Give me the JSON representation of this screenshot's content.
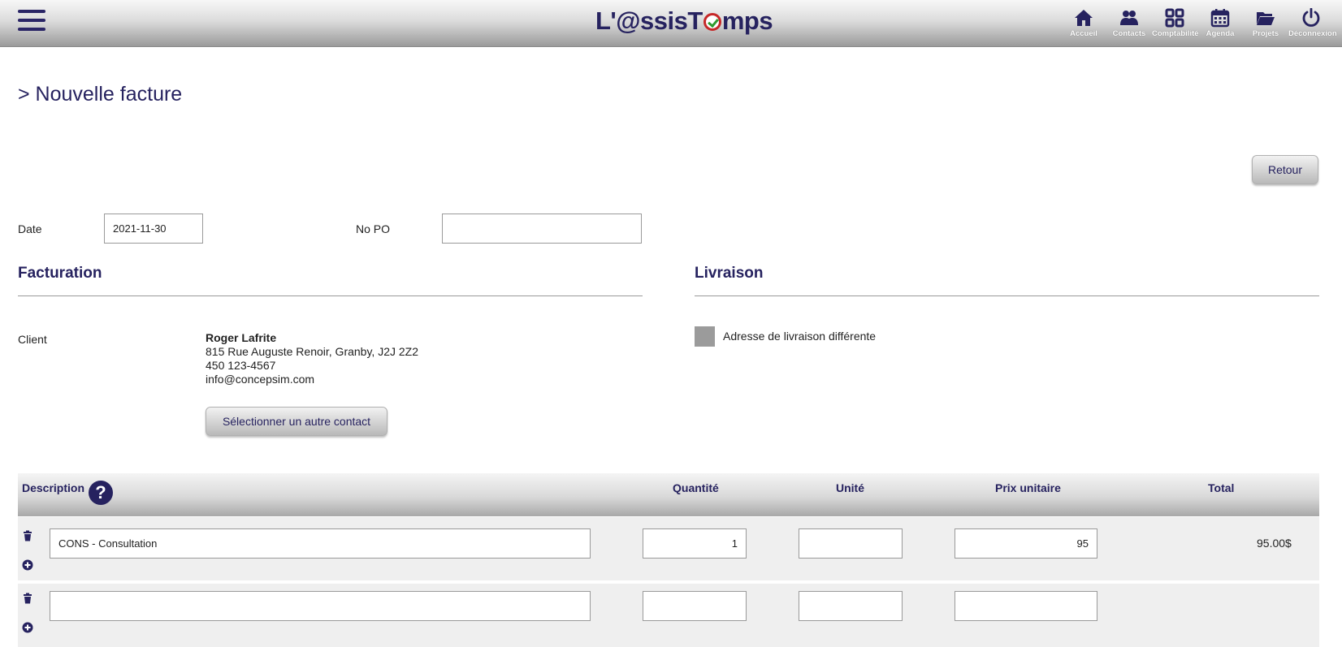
{
  "header": {
    "brand": {
      "prefix": "L'@ssisT",
      "suffix": "mps"
    },
    "nav": [
      {
        "label": "Accueil",
        "icon": "home-icon"
      },
      {
        "label": "Contacts",
        "icon": "contacts-icon"
      },
      {
        "label": "Comptabilité",
        "icon": "grid-icon"
      },
      {
        "label": "Agenda",
        "icon": "calendar-icon"
      },
      {
        "label": "Projets",
        "icon": "folder-icon"
      },
      {
        "label": "Déconnexion",
        "icon": "power-icon"
      }
    ]
  },
  "page": {
    "title": "> Nouvelle facture",
    "back_label": "Retour"
  },
  "form": {
    "date_label": "Date",
    "date_value": "2021-11-30",
    "po_label": "No PO",
    "po_value": ""
  },
  "billing": {
    "title": "Facturation",
    "client_label": "Client",
    "client_name": "Roger Lafrite",
    "client_address": "815 Rue Auguste Renoir, Granby, J2J 2Z2",
    "client_phone": "450 123-4567",
    "client_email": "info@concepsim.com",
    "select_contact_label": "Sélectionner un autre contact"
  },
  "delivery": {
    "title": "Livraison",
    "different_address_label": "Adresse de livraison différente",
    "different_address_checked": false
  },
  "table": {
    "headers": {
      "description": "Description",
      "help_icon": "?",
      "quantity": "Quantité",
      "unit": "Unité",
      "unit_price": "Prix unitaire",
      "total": "Total"
    },
    "rows": [
      {
        "description": "CONS - Consultation",
        "quantity": "1",
        "unit": "",
        "unit_price": "95",
        "total": "95.00$"
      },
      {
        "description": "",
        "quantity": "",
        "unit": "",
        "unit_price": "",
        "total": ""
      }
    ]
  }
}
